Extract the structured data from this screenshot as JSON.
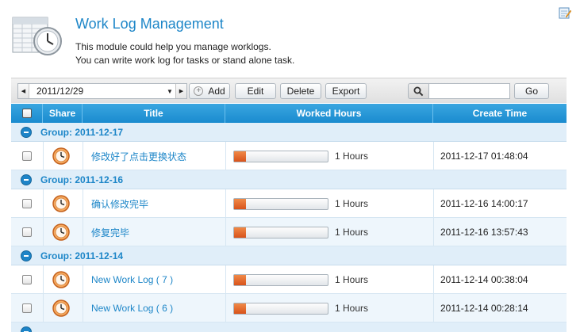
{
  "header": {
    "title": "Work Log Management",
    "description_line1": "This module could help you manage worklogs.",
    "description_line2": "You can write work log for tasks or stand alone task."
  },
  "toolbar": {
    "date_value": "2011/12/29",
    "add_label": "Add",
    "edit_label": "Edit",
    "delete_label": "Delete",
    "export_label": "Export",
    "search_value": "",
    "go_label": "Go"
  },
  "grid": {
    "columns": {
      "share": "Share",
      "title": "Title",
      "worked_hours": "Worked Hours",
      "create_time": "Create Time"
    },
    "groups": [
      {
        "label": "Group: 2011-12-17"
      },
      {
        "label": "Group: 2011-12-16"
      },
      {
        "label": "Group: 2011-12-14"
      }
    ],
    "rows": [
      {
        "title": "修改好了点击更换状态",
        "hours": "1 Hours",
        "progress": 0.13,
        "create_time": "2011-12-17 01:48:04"
      },
      {
        "title": "确认修改完毕",
        "hours": "1 Hours",
        "progress": 0.13,
        "create_time": "2011-12-16 14:00:17"
      },
      {
        "title": "修复完毕",
        "hours": "1 Hours",
        "progress": 0.13,
        "create_time": "2011-12-16 13:57:43"
      },
      {
        "title": "New Work Log ( 7 )",
        "hours": "1 Hours",
        "progress": 0.13,
        "create_time": "2011-12-14 00:38:04"
      },
      {
        "title": "New Work Log ( 6 )",
        "hours": "1 Hours",
        "progress": 0.13,
        "create_time": "2011-12-14 00:28:14"
      }
    ]
  },
  "colors": {
    "accent": "#1d86c8",
    "header_bg": "#2196d8",
    "progress": "#e86a2c",
    "group_bg": "#e0eef9"
  },
  "icons": [
    "worklog-clock-logo",
    "help-edit-icon",
    "search-icon",
    "add-plus-icon",
    "clock-icon",
    "collapse-minus-icon"
  ]
}
